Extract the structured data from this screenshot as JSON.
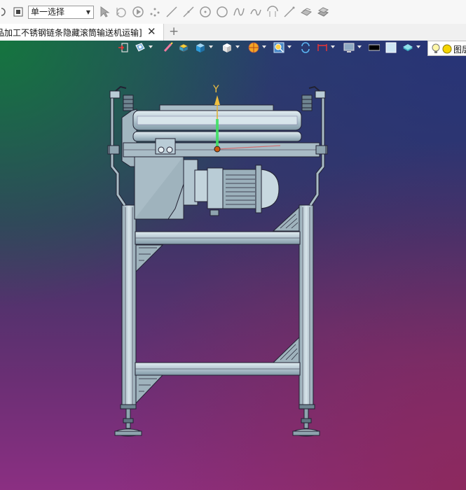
{
  "toolbar": {
    "selection_mode": "单一选择"
  },
  "document_tab": {
    "title": "品加工不锈钢链条隐藏滚筒输送机运输]",
    "close_symbol": "✕",
    "new_tab_symbol": "+"
  },
  "view_toolbar": {
    "render_label": "图层"
  },
  "viewport": {
    "axis_label_y": "Y",
    "background_colors": [
      "#1f7a4a",
      "#29406a",
      "#6a2f74",
      "#8b2f82"
    ]
  },
  "model": {
    "name": "stainless-chain-roller-conveyor",
    "color": "#b9ccd6"
  },
  "icons": {
    "toolbar": [
      "redo-icon",
      "stop-icon",
      "select-cursor-icon",
      "select-cursor-alt-icon",
      "play-icon",
      "point-icon",
      "line-icon",
      "line-alt-icon",
      "circle-center-icon",
      "circle-icon",
      "spline-icon",
      "curve-icon",
      "arc-icon",
      "pen-icon",
      "surface-icon",
      "surface-alt-icon"
    ],
    "view_toolbar": [
      "import-icon",
      "display-icon",
      "measure-icon",
      "box-icon",
      "cube-view-icon",
      "cube-white-icon",
      "section-icon",
      "zoom-icon",
      "refresh-icon",
      "dimension-icon",
      "monitor-icon",
      "color-black-icon",
      "color-white-icon",
      "layer-icon",
      "bulb-icon"
    ]
  }
}
